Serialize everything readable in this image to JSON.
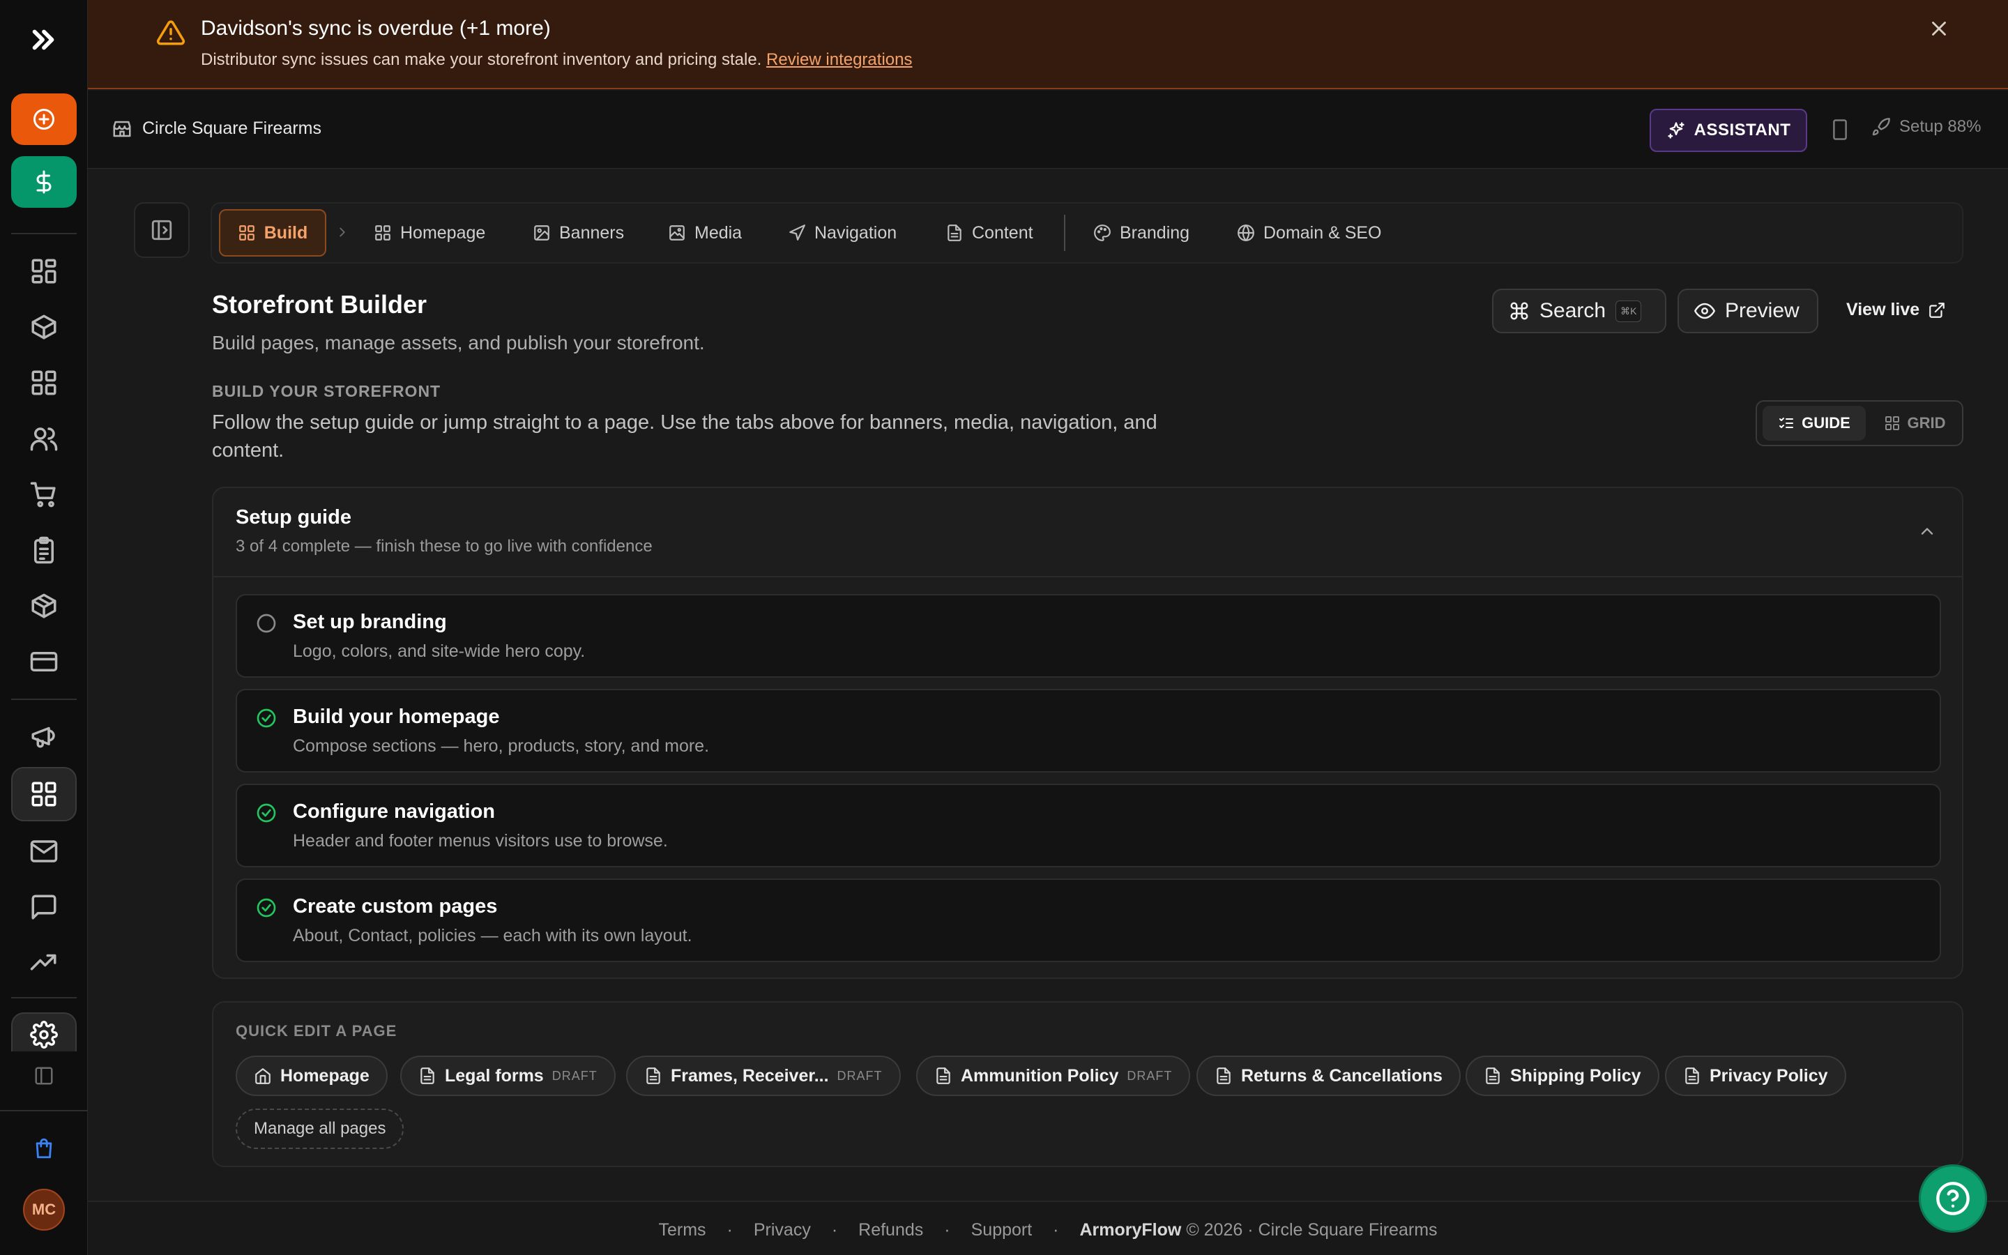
{
  "alert": {
    "title": "Davidson's sync is overdue (+1 more)",
    "text": "Distributor sync issues can make your storefront inventory and pricing stale.",
    "link": "Review integrations"
  },
  "topbar": {
    "store_name": "Circle Square Firearms",
    "assistant_label": "ASSISTANT",
    "setup_label": "Setup 88%"
  },
  "tabs": {
    "build": "Build",
    "items": [
      "Homepage",
      "Banners",
      "Media",
      "Navigation",
      "Content",
      "Branding",
      "Domain & SEO"
    ]
  },
  "header": {
    "title": "Storefront Builder",
    "subtitle": "Build pages, manage assets, and publish your storefront.",
    "search_label": "Search",
    "search_kbd": "⌘K",
    "preview_label": "Preview",
    "view_live_label": "View live"
  },
  "section": {
    "label": "BUILD YOUR STOREFRONT",
    "description": "Follow the setup guide or jump straight to a page. Use the tabs above for banners, media, navigation, and content."
  },
  "view_toggle": {
    "guide": "GUIDE",
    "grid": "GRID",
    "selected": "GUIDE"
  },
  "setup_guide": {
    "title": "Setup guide",
    "subtitle": "3 of 4 complete — finish these to go live with confidence",
    "tasks": [
      {
        "title": "Set up branding",
        "desc": "Logo, colors, and site-wide hero copy.",
        "done": false
      },
      {
        "title": "Build your homepage",
        "desc": "Compose sections — hero, products, story, and more.",
        "done": true
      },
      {
        "title": "Configure navigation",
        "desc": "Header and footer menus visitors use to browse.",
        "done": true
      },
      {
        "title": "Create custom pages",
        "desc": "About, Contact, policies — each with its own layout.",
        "done": true
      }
    ]
  },
  "quick_edit": {
    "label": "QUICK EDIT A PAGE",
    "pages": [
      {
        "name": "Homepage",
        "badge": ""
      },
      {
        "name": "Legal forms",
        "badge": "DRAFT"
      },
      {
        "name": "Frames, Receiver...",
        "badge": "DRAFT"
      },
      {
        "name": "Ammunition Policy",
        "badge": "DRAFT"
      },
      {
        "name": "Returns & Cancellations",
        "badge": ""
      },
      {
        "name": "Shipping Policy",
        "badge": ""
      },
      {
        "name": "Privacy Policy",
        "badge": ""
      }
    ],
    "manage_label": "Manage all pages"
  },
  "footer": {
    "links": [
      "Terms",
      "Privacy",
      "Refunds",
      "Support"
    ],
    "sep": "·",
    "brand": "ArmoryFlow",
    "copyright": "© 2026 · Circle Square Firearms"
  },
  "sidebar": {
    "avatar_initials": "MC",
    "icons": [
      "chevrons-right-icon",
      "plus-circle-icon",
      "dollar-icon",
      "dashboard-icon",
      "package-icon",
      "apps-icon",
      "users-icon",
      "cart-icon",
      "clipboard-icon",
      "box-icon",
      "card-icon",
      "megaphone-icon",
      "storefront-grid-icon",
      "mail-icon",
      "chat-icon",
      "trending-icon",
      "gear-icon",
      "sidebar-toggle-icon",
      "shopping-bag-icon"
    ]
  },
  "colors": {
    "accent": "#ea580c",
    "success": "#22c55e",
    "warning": "#f59e0b",
    "green_button": "#059669",
    "background": "#1a1a1a"
  }
}
